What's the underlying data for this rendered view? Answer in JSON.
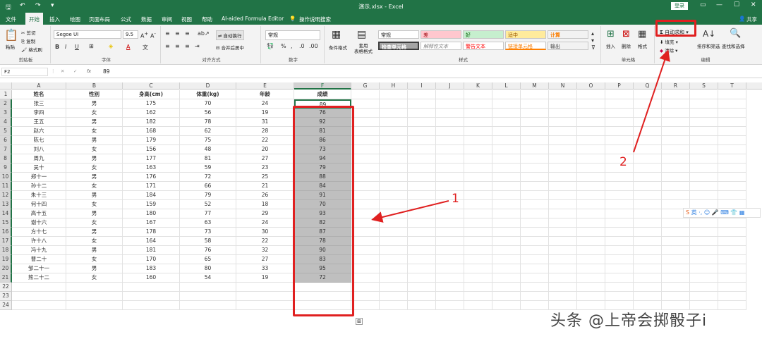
{
  "titlebar": {
    "title": "演示.xlsx - Excel",
    "login": "登录",
    "quick_icons": [
      "save-icon",
      "undo-icon",
      "redo-icon",
      "customize-icon"
    ]
  },
  "menu": {
    "items": [
      "文件",
      "开始",
      "插入",
      "绘图",
      "页面布局",
      "公式",
      "数据",
      "审阅",
      "视图",
      "帮助",
      "AI-aided Formula Editor",
      "操作说明搜索"
    ],
    "active": "开始",
    "share": "共享"
  },
  "ribbon": {
    "clipboard": {
      "paste": "粘贴",
      "cut": "剪切",
      "copy": "复制",
      "format_painter": "格式刷",
      "label": "剪贴板"
    },
    "font": {
      "name": "Segoe UI",
      "size": "9.5",
      "label": "字体"
    },
    "alignment": {
      "wrap": "自动换行",
      "merge": "合并后居中",
      "label": "对齐方式"
    },
    "number": {
      "format": "常规",
      "label": "数字"
    },
    "styles": {
      "conditional": "条件格式",
      "table": "套用\n表格格式",
      "cells": [
        "常规",
        "差",
        "好",
        "适中",
        "计算",
        "检查单元格",
        "解释性文本",
        "警告文本",
        "链接单元格",
        "输出"
      ],
      "label": "样式"
    },
    "cells_grp": {
      "insert": "插入",
      "delete": "删除",
      "format": "格式",
      "label": "单元格"
    },
    "editing": {
      "autosum": "自动求和",
      "fill": "填充",
      "clear": "清除",
      "sort": "排序和筛选",
      "find": "查找和选择",
      "label": "编辑"
    }
  },
  "formula": {
    "namebox": "F2",
    "fx": "fx",
    "value": "89"
  },
  "columns": [
    "A",
    "B",
    "C",
    "D",
    "E",
    "F",
    "G",
    "H",
    "I",
    "J",
    "K",
    "L",
    "M",
    "N",
    "O",
    "P",
    "Q",
    "R",
    "S",
    "T"
  ],
  "headers": [
    "姓名",
    "性别",
    "身高(cm)",
    "体重(kg)",
    "年龄",
    "成绩"
  ],
  "rows": [
    [
      "张三",
      "男",
      "175",
      "70",
      "24",
      "89"
    ],
    [
      "李四",
      "女",
      "162",
      "56",
      "19",
      "76"
    ],
    [
      "王五",
      "男",
      "182",
      "78",
      "31",
      "92"
    ],
    [
      "赵六",
      "女",
      "168",
      "62",
      "28",
      "81"
    ],
    [
      "陈七",
      "男",
      "179",
      "75",
      "22",
      "86"
    ],
    [
      "刘八",
      "女",
      "156",
      "48",
      "20",
      "73"
    ],
    [
      "周九",
      "男",
      "177",
      "81",
      "27",
      "94"
    ],
    [
      "吴十",
      "女",
      "163",
      "59",
      "23",
      "79"
    ],
    [
      "郑十一",
      "男",
      "176",
      "72",
      "25",
      "88"
    ],
    [
      "孙十二",
      "女",
      "171",
      "66",
      "21",
      "84"
    ],
    [
      "朱十三",
      "男",
      "184",
      "79",
      "26",
      "91"
    ],
    [
      "何十四",
      "女",
      "159",
      "52",
      "18",
      "70"
    ],
    [
      "高十五",
      "男",
      "180",
      "77",
      "29",
      "93"
    ],
    [
      "谢十六",
      "女",
      "167",
      "63",
      "24",
      "82"
    ],
    [
      "方十七",
      "男",
      "178",
      "73",
      "30",
      "87"
    ],
    [
      "许十八",
      "女",
      "164",
      "58",
      "22",
      "78"
    ],
    [
      "冯十九",
      "男",
      "181",
      "76",
      "32",
      "90"
    ],
    [
      "曹二十",
      "女",
      "170",
      "65",
      "27",
      "83"
    ],
    [
      "邹二十一",
      "男",
      "183",
      "80",
      "33",
      "95"
    ],
    [
      "熊二十二",
      "女",
      "160",
      "54",
      "19",
      "72"
    ]
  ],
  "annotations": {
    "one": "1",
    "two": "2"
  },
  "ime": {
    "label": "英"
  },
  "watermark": "头条 @上帝会掷骰子i",
  "colors": {
    "excel_green": "#217346",
    "selection": "#bfbfbf",
    "annotation_red": "#e02020"
  }
}
